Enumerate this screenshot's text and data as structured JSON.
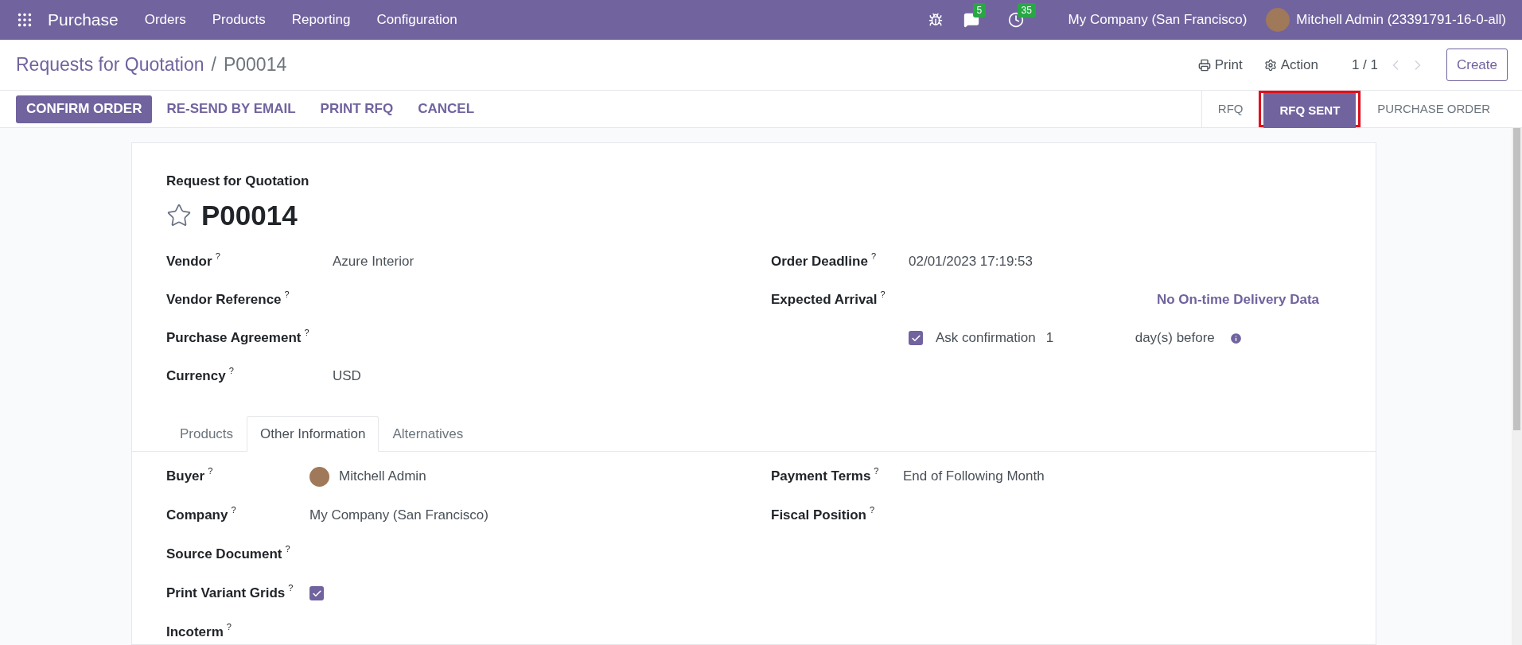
{
  "navbar": {
    "app": "Purchase",
    "menus": [
      "Orders",
      "Products",
      "Reporting",
      "Configuration"
    ],
    "messages_count": "5",
    "activities_count": "35",
    "company": "My Company (San Francisco)",
    "user": "Mitchell Admin (23391791-16-0-all)"
  },
  "breadcrumb": {
    "parent": "Requests for Quotation",
    "separator": "/",
    "current": "P00014"
  },
  "control_panel": {
    "print": "Print",
    "action": "Action",
    "pager": "1 / 1",
    "create": "Create"
  },
  "actions": [
    {
      "label": "CONFIRM ORDER",
      "primary": true
    },
    {
      "label": "RE-SEND BY EMAIL",
      "primary": false
    },
    {
      "label": "PRINT RFQ",
      "primary": false
    },
    {
      "label": "CANCEL",
      "primary": false
    }
  ],
  "statusbar": [
    {
      "label": "RFQ",
      "selected": false,
      "highlighted": false
    },
    {
      "label": "RFQ SENT",
      "selected": true,
      "highlighted": true
    },
    {
      "label": "PURCHASE ORDER",
      "selected": false,
      "highlighted": false
    }
  ],
  "sheet": {
    "subtitle": "Request for Quotation",
    "starred": false,
    "name": "P00014",
    "left_fields": [
      {
        "label": "Vendor",
        "help": "?",
        "value": "Azure Interior"
      },
      {
        "label": "Vendor Reference",
        "help": "?"
      },
      {
        "label": "Purchase Agreement",
        "help": "?"
      },
      {
        "label": "Currency",
        "help": "?",
        "value": "USD"
      }
    ],
    "order_deadline": {
      "label": "Order Deadline",
      "help": "?",
      "value": "02/01/2023 17:19:53"
    },
    "expected_arrival": {
      "label": "Expected Arrival",
      "help": "?",
      "link": "No On-time Delivery Data"
    },
    "ask_confirmation": {
      "checked": true,
      "label": "Ask confirmation",
      "days": "1",
      "suffix": "day(s) before"
    },
    "tabs": [
      {
        "label": "Products",
        "selected": false
      },
      {
        "label": "Other Information",
        "selected": true
      },
      {
        "label": "Alternatives",
        "selected": false
      }
    ],
    "other_left": [
      {
        "kind": "user",
        "label": "Buyer",
        "help": "?",
        "value": "Mitchell Admin"
      },
      {
        "kind": "text",
        "label": "Company",
        "help": "?",
        "value": "My Company (San Francisco)"
      },
      {
        "kind": "text",
        "label": "Source Document",
        "help": "?"
      },
      {
        "kind": "checkbox",
        "label": "Print Variant Grids",
        "help": "?",
        "checked": true
      },
      {
        "kind": "text",
        "label": "Incoterm",
        "help": "?"
      }
    ],
    "other_right": [
      {
        "label": "Payment Terms",
        "help": "?",
        "value": "End of Following Month"
      },
      {
        "label": "Fiscal Position",
        "help": "?"
      }
    ]
  }
}
